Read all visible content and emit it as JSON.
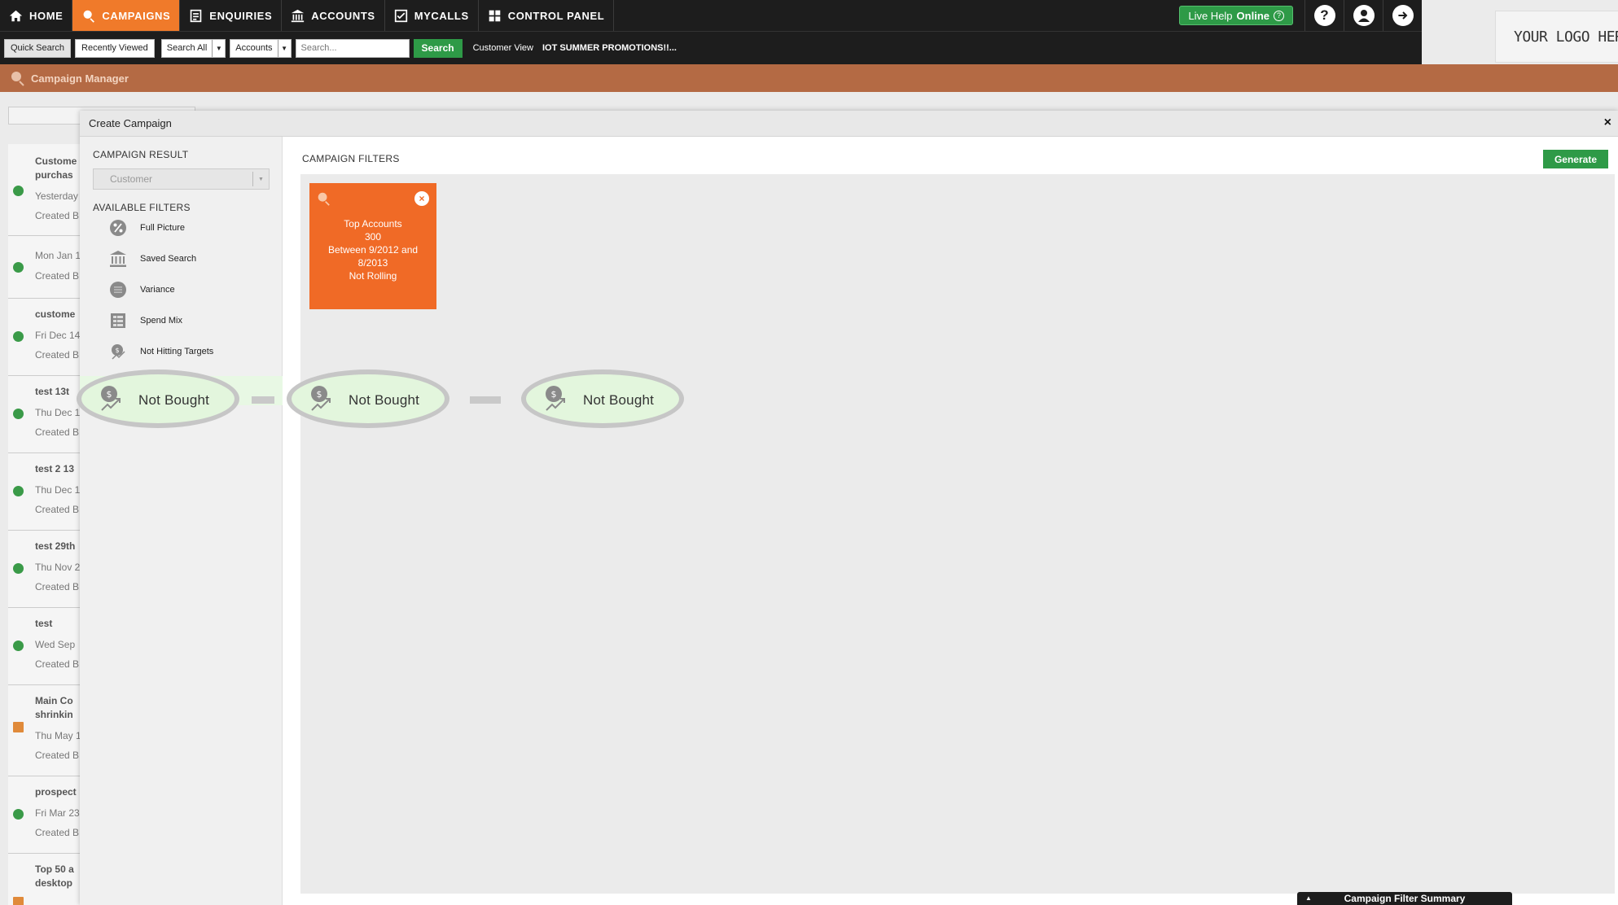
{
  "nav": {
    "items": [
      {
        "label": "HOME",
        "icon": "home-icon"
      },
      {
        "label": "CAMPAIGNS",
        "icon": "campaign-icon",
        "active": true
      },
      {
        "label": "ENQUIRIES",
        "icon": "enquiries-icon"
      },
      {
        "label": "ACCOUNTS",
        "icon": "bank-icon"
      },
      {
        "label": "MYCALLS",
        "icon": "checklist-icon"
      },
      {
        "label": "CONTROL PANEL",
        "icon": "grid-icon"
      }
    ],
    "live_help": "Live Help",
    "live_help_status": "Online",
    "help_icon": "?",
    "accent": "#f07a2a"
  },
  "logo": {
    "text": "YOUR LOGO HERE"
  },
  "searchbar": {
    "quick_search": "Quick Search",
    "recently_viewed": "Recently Viewed",
    "search_all": "Search All",
    "accounts": "Accounts",
    "search_placeholder": "Search...",
    "search_button": "Search",
    "customer_view": "Customer View",
    "promo": "IOT SUMMER PROMOTIONS!!..."
  },
  "campaign_manager": {
    "title": "Campaign Manager"
  },
  "bg_list": [
    {
      "title": "Custome",
      "title2": "purchas",
      "date": "Yesterday",
      "created": "Created B",
      "status": "green"
    },
    {
      "title": "",
      "date": "Mon Jan 1",
      "created": "Created B",
      "status": "green"
    },
    {
      "title": "custome",
      "date": "Fri Dec 14",
      "created": "Created B",
      "status": "green"
    },
    {
      "title": "test 13t",
      "date": "Thu Dec 1",
      "created": "Created B",
      "status": "green"
    },
    {
      "title": "test 2 13",
      "date": "Thu Dec 1",
      "created": "Created B",
      "status": "green"
    },
    {
      "title": "test 29th",
      "date": "Thu Nov 2",
      "created": "Created B",
      "status": "green"
    },
    {
      "title": "test",
      "date": "Wed Sep",
      "created": "Created B",
      "status": "green"
    },
    {
      "title": "Main Co",
      "title2": "shrinkin",
      "date": "Thu May 1",
      "created": "Created B",
      "status": "orange"
    },
    {
      "title": "prospect",
      "date": "Fri Mar 23",
      "created": "Created B",
      "status": "green"
    },
    {
      "title": "Top 50 a",
      "title2": "desktop",
      "date": "",
      "created": "",
      "status": "orange"
    }
  ],
  "modal": {
    "title": "Create Campaign",
    "close": "×",
    "campaign_result_label": "CAMPAIGN RESULT",
    "campaign_result_value": "Customer",
    "available_filters_label": "AVAILABLE FILTERS",
    "filters": [
      {
        "label": "Full Picture",
        "icon": "percent-icon"
      },
      {
        "label": "Saved Search",
        "icon": "bank-icon"
      },
      {
        "label": "Variance",
        "icon": "variance-icon"
      },
      {
        "label": "Spend Mix",
        "icon": "spend-mix-icon"
      },
      {
        "label": "Not Hitting Targets",
        "icon": "target-icon"
      }
    ],
    "campaign_filters_label": "CAMPAIGN FILTERS",
    "generate": "Generate",
    "active_filter": {
      "line1": "Top Accounts",
      "line2": "300",
      "line3": "Between 9/2012 and",
      "line4": "8/2013",
      "line5": "Not Rolling",
      "close": "×"
    },
    "drag_chain": [
      {
        "label": "Not Bought"
      },
      {
        "label": "Not Bought"
      },
      {
        "label": "Not Bought"
      }
    ]
  },
  "summary_tab": {
    "label": "Campaign Filter Summary",
    "arrow": "▲"
  }
}
